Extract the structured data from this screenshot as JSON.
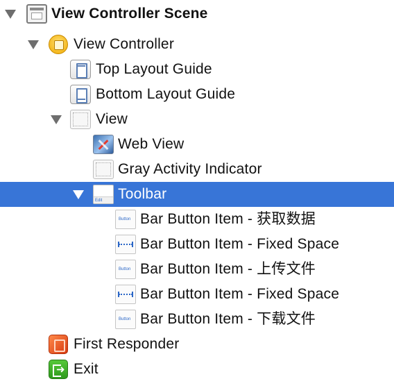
{
  "outline": {
    "selection_color": "#3875d7",
    "items": [
      {
        "label": "View Controller Scene",
        "icon": "scene-icon",
        "expanded": true
      },
      {
        "label": "View Controller",
        "icon": "view-controller-icon",
        "expanded": true
      },
      {
        "label": "Top Layout Guide",
        "icon": "top-layout-guide-icon"
      },
      {
        "label": "Bottom Layout Guide",
        "icon": "bottom-layout-guide-icon"
      },
      {
        "label": "View",
        "icon": "view-icon",
        "expanded": true
      },
      {
        "label": "Web View",
        "icon": "web-view-icon"
      },
      {
        "label": "Gray Activity Indicator",
        "icon": "activity-indicator-icon"
      },
      {
        "label": "Toolbar",
        "icon": "toolbar-icon",
        "expanded": true,
        "selected": true
      },
      {
        "label": "Bar Button Item - 获取数据",
        "icon": "bar-button-item-icon"
      },
      {
        "label": "Bar Button Item - Fixed Space",
        "icon": "fixed-space-icon"
      },
      {
        "label": "Bar Button Item - 上传文件",
        "icon": "bar-button-item-icon"
      },
      {
        "label": "Bar Button Item - Fixed Space",
        "icon": "fixed-space-icon"
      },
      {
        "label": "Bar Button Item - 下载文件",
        "icon": "bar-button-item-icon"
      },
      {
        "label": "First Responder",
        "icon": "first-responder-icon"
      },
      {
        "label": "Exit",
        "icon": "exit-icon"
      }
    ]
  }
}
